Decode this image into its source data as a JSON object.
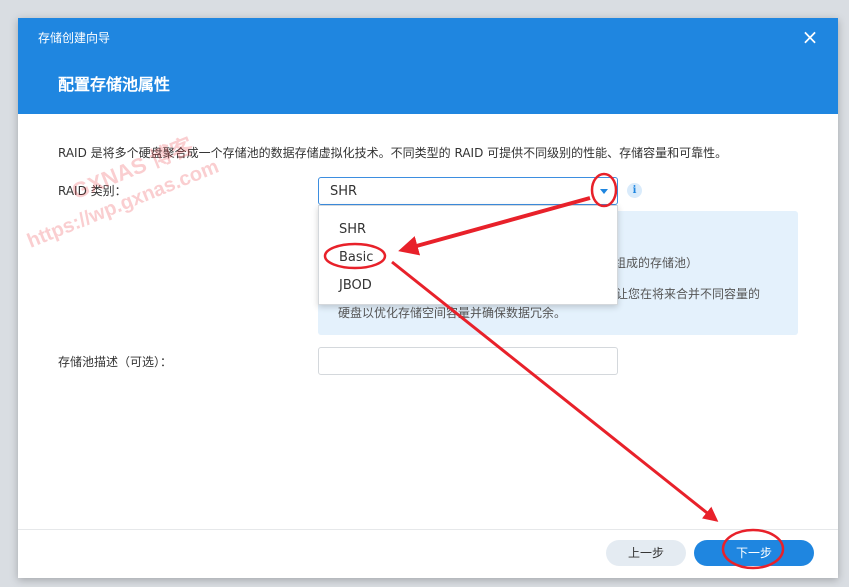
{
  "dialog": {
    "wizard_title": "存储创建向导",
    "close_icon": "close-icon",
    "page_title": "配置存储池属性"
  },
  "form": {
    "description": "RAID 是将多个硬盘聚合成一个存储池的数据存储虚拟化技术。不同类型的 RAID 可提供不同级别的性能、存储容量和可靠性。",
    "raid_label": "RAID 类别：",
    "raid_selected": "SHR",
    "raid_options": [
      "SHR",
      "Basic",
      "JBOD"
    ],
    "info_panel": {
      "line1": "组成的存储池）",
      "line2": "让您在将来合并不同容量的",
      "line3": "硬盘以优化存储空间容量并确保数据冗余。"
    },
    "pool_desc_label": "存储池描述（可选）：",
    "pool_desc_value": ""
  },
  "footer": {
    "prev_label": "上一步",
    "next_label": "下一步"
  },
  "watermark": {
    "line1": "GXNAS 博客",
    "line2": "https://wp.gxnas.com"
  },
  "colors": {
    "header": "#1f86e0",
    "accent": "#1f86e0",
    "annotation": "#e8212a",
    "info_bg": "#e4f1fc"
  }
}
